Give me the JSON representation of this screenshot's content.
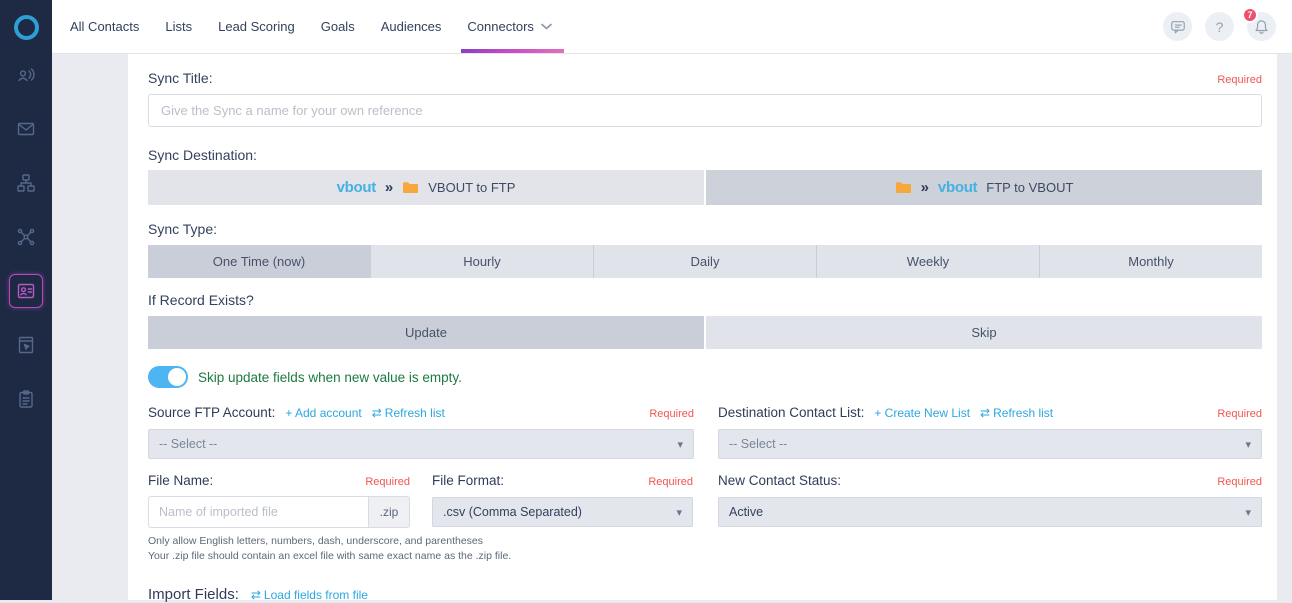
{
  "topnav": {
    "items": [
      "All Contacts",
      "Lists",
      "Lead Scoring",
      "Goals",
      "Audiences"
    ],
    "active_item": "Connectors",
    "help_icon": "?",
    "notification_badge": "7"
  },
  "icons": {
    "caret": "▾",
    "refresh": "⇄",
    "double_arrow": "»"
  },
  "colors": {
    "sidebar_bg": "#1e2a44",
    "accent_blue": "#2ba7e0",
    "brand_blue": "#45b0e2",
    "required_red": "#f0564f",
    "underline_gradient": "#8a3fc6 → #e070c0",
    "toggle_on": "#4db5f2",
    "selected_segment": "#c9ced8",
    "toggle_label_green": "#1d7a42"
  },
  "sidebar": {
    "items": [
      {
        "icon": "vbout-logo"
      },
      {
        "icon": "social-media"
      },
      {
        "icon": "email"
      },
      {
        "icon": "automation"
      },
      {
        "icon": "integrations"
      },
      {
        "icon": "contacts",
        "active": true
      },
      {
        "icon": "landing-pages"
      },
      {
        "icon": "forms"
      }
    ]
  },
  "form": {
    "required": "Required",
    "sync_title": {
      "label": "Sync Title:",
      "placeholder": "Give the Sync a name for your own reference"
    },
    "sync_destination": {
      "label": "Sync Destination:",
      "options": [
        {
          "brand": "vbout",
          "text": "VBOUT to FTP"
        },
        {
          "brand": "vbout",
          "text": "FTP to VBOUT"
        }
      ],
      "selected": "FTP to VBOUT"
    },
    "sync_type": {
      "label": "Sync Type:",
      "options": [
        "One Time (now)",
        "Hourly",
        "Daily",
        "Weekly",
        "Monthly"
      ],
      "selected": "One Time (now)"
    },
    "if_record_exists": {
      "label": "If Record Exists?",
      "options": [
        "Update",
        "Skip"
      ],
      "selected": "Update"
    },
    "skip_update_toggle": {
      "label": "Skip update fields when new value is empty.",
      "state": "on"
    },
    "source_ftp_account": {
      "label": "Source FTP Account:",
      "add_account_link": "+ Add account",
      "refresh_link": "Refresh list",
      "value": "-- Select --"
    },
    "destination_contact_list": {
      "label": "Destination Contact List:",
      "create_list_link": "+ Create New List",
      "refresh_link": "Refresh list",
      "value": "-- Select --"
    },
    "file_name": {
      "label": "File Name:",
      "placeholder": "Name of imported file",
      "suffix": ".zip"
    },
    "file_format": {
      "label": "File Format:",
      "value": ".csv (Comma Separated)"
    },
    "new_contact_status": {
      "label": "New Contact Status:",
      "value": "Active"
    },
    "help_texts": [
      "Only allow English letters, numbers, dash, underscore, and parentheses",
      "Your .zip file should contain an excel file with same exact name as the .zip file."
    ],
    "import_fields": {
      "label": "Import Fields:",
      "load_link": "Load fields from file"
    }
  }
}
